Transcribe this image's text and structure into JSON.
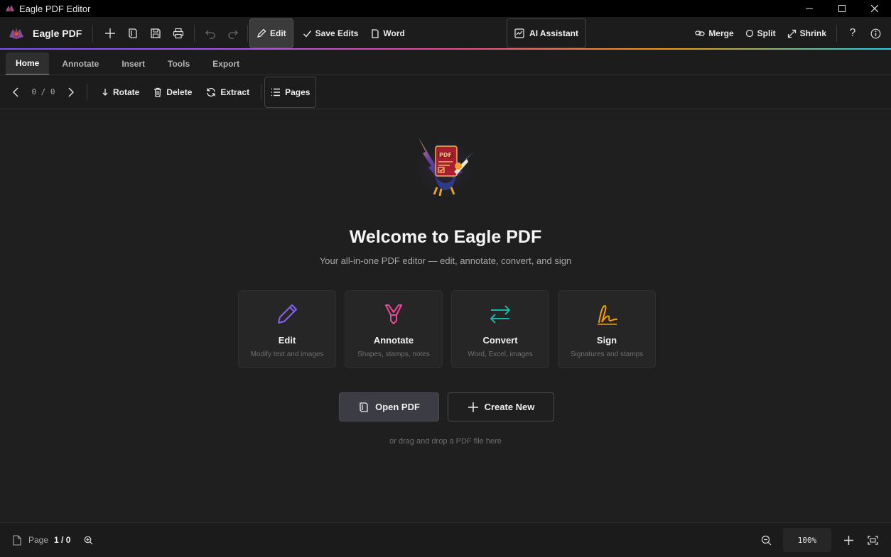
{
  "window": {
    "title": "Eagle PDF Editor"
  },
  "toolbar": {
    "brand": "Eagle PDF",
    "edit_label": "Edit",
    "save_edits_label": "Save Edits",
    "word_label": "Word",
    "ai_label": "AI Assistant",
    "merge_label": "Merge",
    "split_label": "Split",
    "shrink_label": "Shrink",
    "help_glyph": "?"
  },
  "tabs": [
    {
      "label": "Home",
      "active": true
    },
    {
      "label": "Annotate",
      "active": false
    },
    {
      "label": "Insert",
      "active": false
    },
    {
      "label": "Tools",
      "active": false
    },
    {
      "label": "Export",
      "active": false
    }
  ],
  "subbar": {
    "page_count": "0 / 0",
    "rotate_label": "Rotate",
    "delete_label": "Delete",
    "extract_label": "Extract",
    "pages_label": "Pages"
  },
  "welcome": {
    "title": "Welcome to Eagle PDF",
    "subtitle": "Your all-in-one PDF editor — edit, annotate, convert, and sign",
    "cards": [
      {
        "title": "Edit",
        "desc": "Modify text and images",
        "icon": "pencil-icon",
        "color": "#8b5cf6"
      },
      {
        "title": "Annotate",
        "desc": "Shapes, stamps, notes",
        "icon": "highlighter-icon",
        "color": "#ec4899"
      },
      {
        "title": "Convert",
        "desc": "Word, Excel, images",
        "icon": "swap-arrows-icon",
        "color": "#14b8a6"
      },
      {
        "title": "Sign",
        "desc": "Signatures and stamps",
        "icon": "signature-icon",
        "color": "#f59e0b"
      }
    ],
    "open_label": "Open PDF",
    "create_label": "Create New",
    "drop_hint": "or drag and drop a PDF file here"
  },
  "status": {
    "page_label": "Page",
    "page_value": "1 / 0",
    "zoom": "100%"
  }
}
